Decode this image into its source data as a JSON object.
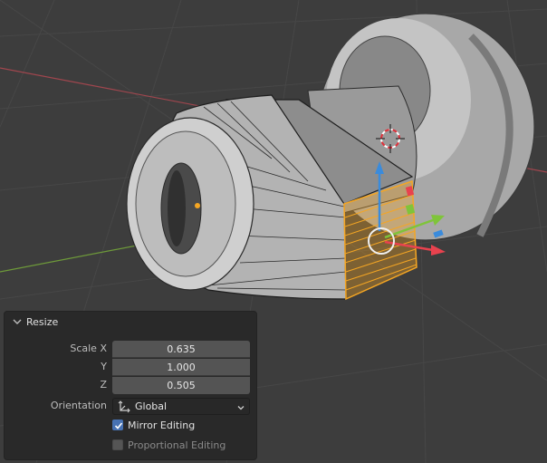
{
  "viewport": {
    "background_color": "#3d3d3d",
    "grid_color": "#4a4a4a",
    "x_axis_color": "#a0464e",
    "y_axis_color": "#6e9a3a",
    "selection_color": "#f5a623",
    "gizmo": {
      "x_color": "#e8424e",
      "y_color": "#7fc43a",
      "z_color": "#3a8bdc"
    }
  },
  "redo_panel": {
    "title": "Resize",
    "collapse_icon": "chevron-down-icon",
    "scale_label_x": "Scale X",
    "scale_label_y": "Y",
    "scale_label_z": "Z",
    "scale_x": "0.635",
    "scale_y": "1.000",
    "scale_z": "0.505",
    "orientation_label": "Orientation",
    "orientation_value": "Global",
    "orientation_icon": "global-orientation-icon",
    "mirror_editing_label": "Mirror Editing",
    "mirror_editing_checked": true,
    "proportional_editing_label": "Proportional Editing",
    "proportional_editing_checked": false
  }
}
